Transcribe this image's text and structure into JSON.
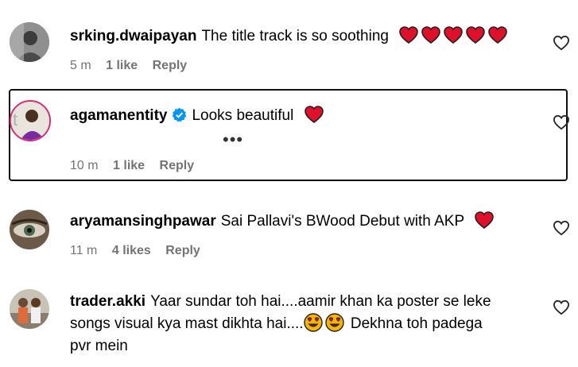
{
  "comments": [
    {
      "username": "srking.dwaipayan",
      "text": "The title track is so soothing",
      "emojis": [
        "red-heart",
        "red-heart",
        "red-heart",
        "red-heart",
        "red-heart"
      ],
      "time": "5 m",
      "likes": "1 like",
      "reply": "Reply"
    },
    {
      "username": "agamanentity",
      "verified": true,
      "text": "Looks beautiful",
      "emojis": [
        "red-heart"
      ],
      "more": "•••",
      "time": "10 m",
      "likes": "1 like",
      "reply": "Reply"
    },
    {
      "username": "aryamansinghpawar",
      "text": "Sai Pallavi's BWood Debut with AKP",
      "emojis": [
        "red-heart"
      ],
      "time": "11 m",
      "likes": "4 likes",
      "reply": "Reply"
    },
    {
      "username": "trader.akki",
      "text_line1": "Yaar sundar toh hai....aamir khan ka poster se leke",
      "text_line2a": "songs visual kya mast dikhta hai....",
      "emojis": [
        "heart-eyes-face",
        "heart-eyes-face"
      ],
      "text_line2b": "Dekhna toh padega",
      "text_line3": "pvr mein"
    }
  ],
  "colors": {
    "meta_gray": "#737373",
    "heart_red": "#e0102a",
    "verified_blue": "#0095f6",
    "highlight_border": "#111111"
  }
}
